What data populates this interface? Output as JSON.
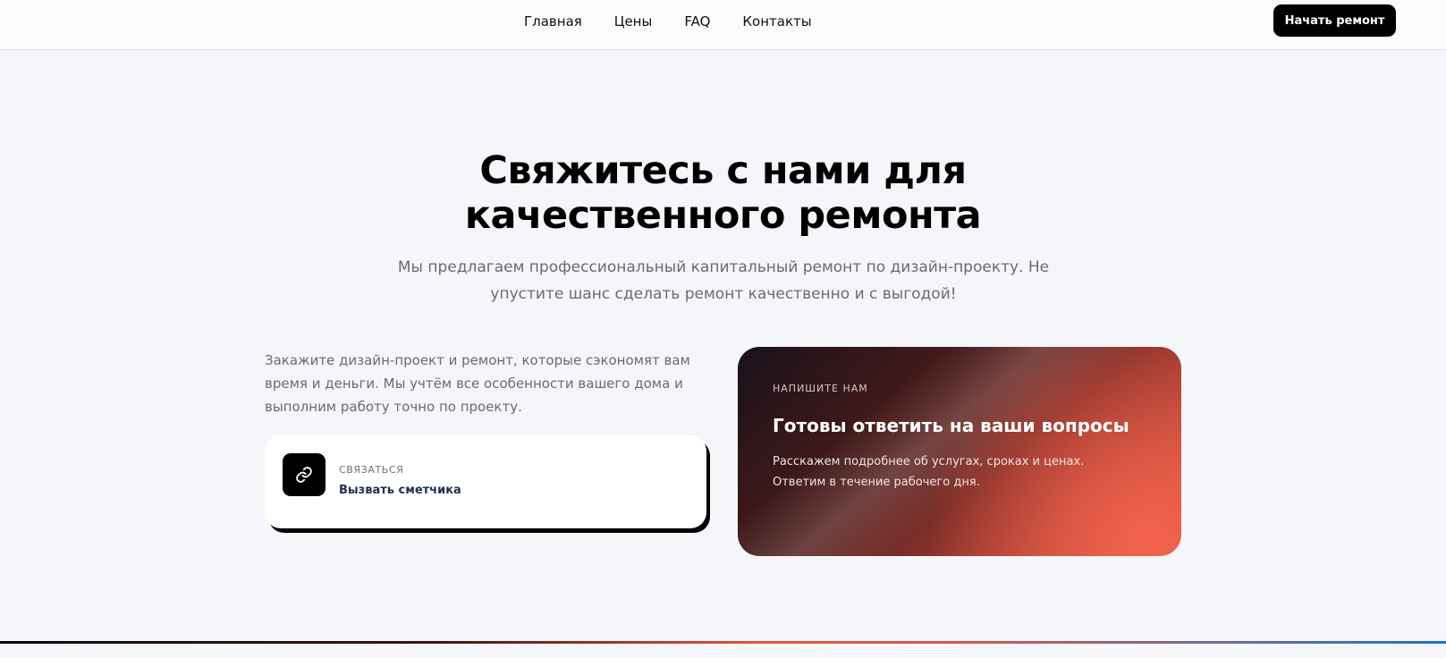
{
  "header": {
    "nav": [
      "Главная",
      "Цены",
      "FAQ",
      "Контакты"
    ],
    "cta_label": "Начать ремонт"
  },
  "hero": {
    "title_line1": "Свяжитесь с нами для",
    "title_line2": "качественного ремонта",
    "subtitle": "Мы предлагаем профессиональный капитальный ремонт по дизайн-проекту. Не упустите шанс сделать ремонт качественно и с выгодой!"
  },
  "intro": {
    "text": "Закажите дизайн-проект и ремонт, которые сэкономят вам время и деньги. Мы учтём все особенности вашего дома и выполним работу точно по проекту."
  },
  "contact_card": {
    "icon": "link-icon",
    "kicker": "Связаться",
    "action": "Вызвать сметчика"
  },
  "promo_card": {
    "kicker": "Напишите нам",
    "title": "Готовы ответить на ваши вопросы",
    "text": "Расскажем подробнее об услугах, сроках и ценах. Ответим в течение рабочего дня."
  },
  "colors": {
    "background": "#f5f6fa",
    "primary": "#000000",
    "accent": "#f0624b",
    "muted_text": "#6a6a72"
  }
}
